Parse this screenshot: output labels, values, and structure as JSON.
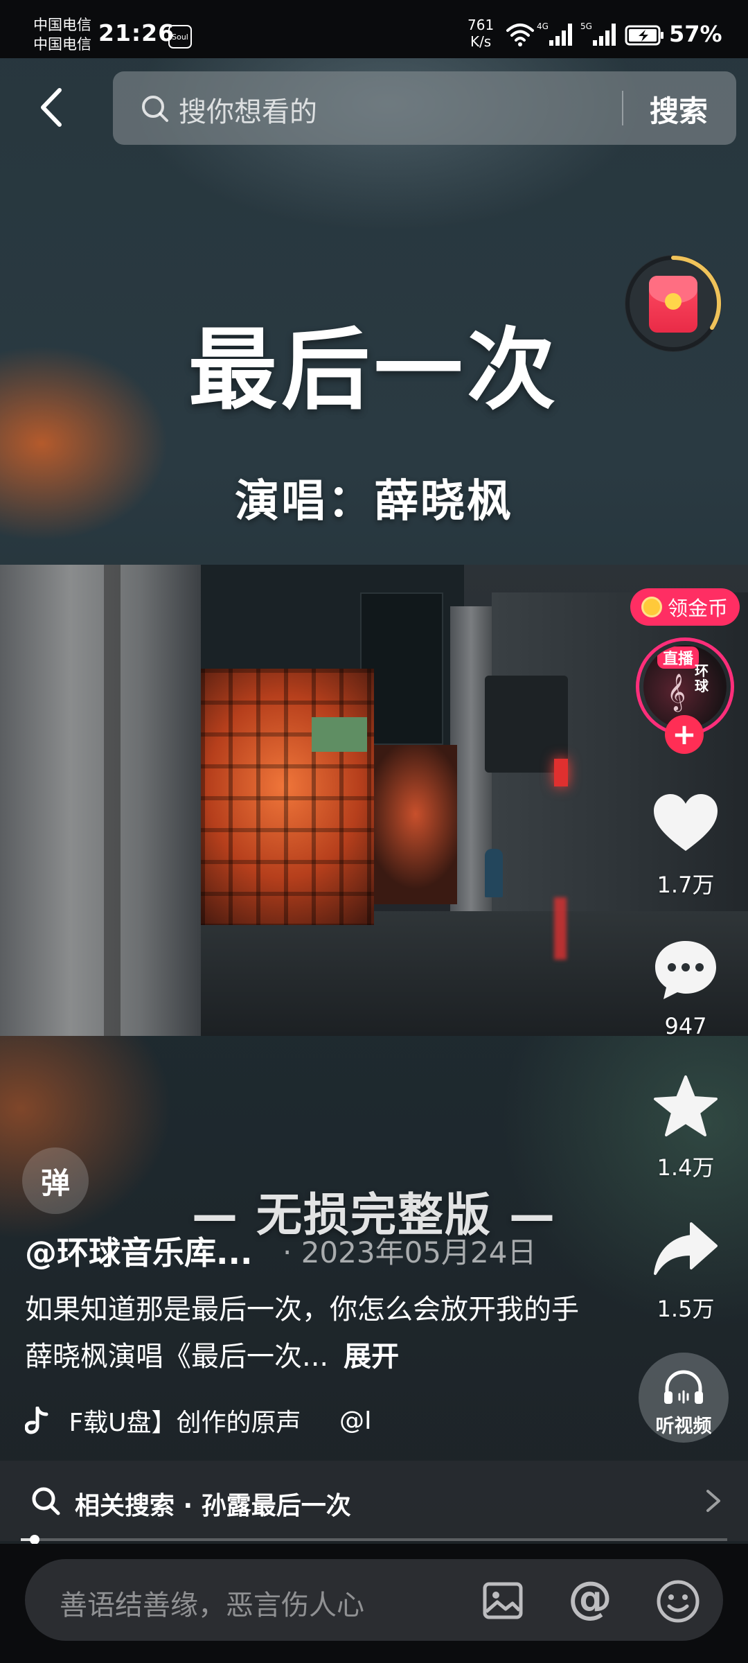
{
  "status_bar": {
    "carrier_1": "中国电信",
    "carrier_2": "中国电信",
    "time": "21:26",
    "app_badge": "Soul",
    "net_speed_value": "761",
    "net_speed_unit": "K/s",
    "sig1_type": "4G",
    "sig2_type": "5G",
    "battery": "57%"
  },
  "search": {
    "placeholder": "搜你想看的",
    "button": "搜索"
  },
  "video": {
    "title": "最后一次",
    "singer_line": "演唱：薛晓枫",
    "version_line": "— 无损完整版 —"
  },
  "rail": {
    "coin_badge": "领金币",
    "live_label": "直播",
    "avatar_name": "环球",
    "follow": "+",
    "likes": "1.7万",
    "comments": "947",
    "favorites": "1.4万",
    "shares": "1.5万",
    "listen": "听视频"
  },
  "info": {
    "danmaku": "弹",
    "author": "@环球音乐库...",
    "date": "· 2023年05月24日",
    "description": "如果知道那是最后一次，你怎么会放开我的手 薛晓枫演唱《最后一次...",
    "expand": "展开",
    "music": "F载U盘】创作的原声",
    "music_at": "@I"
  },
  "related": {
    "text": "相关搜索 · 孙露最后一次"
  },
  "progress": {
    "fraction": 0.02
  },
  "comment_bar": {
    "placeholder": "善语结善缘，恶言伤人心"
  },
  "colors": {
    "accent_pink": "#ff2e63",
    "coin_gold": "#ffc93a"
  }
}
